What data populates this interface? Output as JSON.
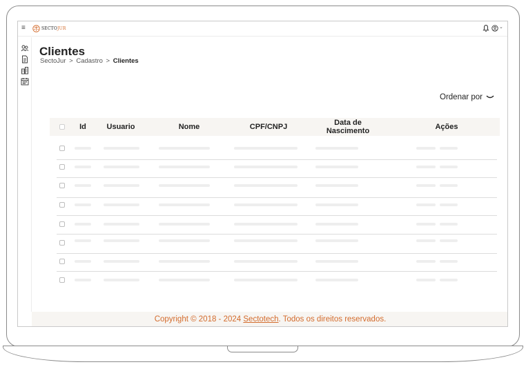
{
  "app": {
    "brand_prefix": "SECTO",
    "brand_suffix": "JUR",
    "brand_color": "#d36b2c",
    "icons": [
      "menu-icon",
      "scales-logo-icon",
      "bell-icon",
      "user-icon",
      "chevron-down-icon"
    ]
  },
  "sidebar": {
    "items": [
      {
        "icon": "users-icon"
      },
      {
        "icon": "document-icon"
      },
      {
        "icon": "building-icon"
      },
      {
        "icon": "calendar-icon"
      }
    ]
  },
  "page": {
    "title": "Clientes",
    "breadcrumb": [
      "SectoJur",
      "Cadastro",
      "Clientes"
    ],
    "breadcrumb_sep": ">"
  },
  "sort": {
    "label": "Ordenar por"
  },
  "table": {
    "columns": [
      "Id",
      "Usuario",
      "Nome",
      "CPF/CNPJ",
      "Data de Nascimento",
      "Ações"
    ],
    "row_count_shown": 8,
    "rows_state": "loading-skeleton"
  },
  "footer": {
    "prefix": "Copyright © 2018 - 2024 ",
    "link": "Sectotech",
    "suffix": ". Todos os direitos reservados."
  }
}
